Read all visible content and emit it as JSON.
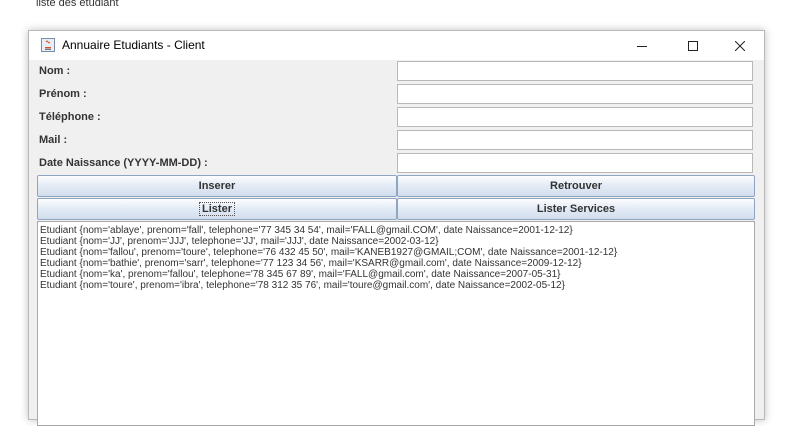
{
  "background_caption": "liste des etudiant",
  "window": {
    "title": "Annuaire Etudiants - Client",
    "controls": [
      "minimize-icon",
      "maximize-icon",
      "close-icon"
    ]
  },
  "form": {
    "fields": [
      {
        "label": "Nom :",
        "value": ""
      },
      {
        "label": "Prénom :",
        "value": ""
      },
      {
        "label": "Téléphone :",
        "value": ""
      },
      {
        "label": "Mail :",
        "value": ""
      },
      {
        "label": "Date Naissance (YYYY-MM-DD) :",
        "value": ""
      }
    ]
  },
  "buttons": {
    "inserer": "Inserer",
    "retrouver": "Retrouver",
    "lister": "Lister",
    "lister_services": "Lister Services"
  },
  "output": {
    "lines": [
      "Etudiant {nom='ablaye', prenom='fall', telephone='77 345 34 54', mail='FALL@gmail.COM', date Naissance=2001-12-12}",
      "Etudiant {nom='JJ', prenom='JJJ', telephone='JJ', mail='JJJ', date Naissance=2002-03-12}",
      "Etudiant {nom='fallou', prenom='toure', telephone='76 432 45 50', mail='KANEB1927@GMAIL;COM', date Naissance=2001-12-12}",
      "Etudiant {nom='bathie', prenom='sarr', telephone='77 123 34 56', mail='KSARR@gmail.com', date Naissance=2009-12-12}",
      "Etudiant {nom='ka', prenom='fallou', telephone='78 345 67 89', mail='FALL@gmail.com', date Naissance=2007-05-31}",
      "Etudiant {nom='toure', prenom='ibra', telephone='78 312 35 76', mail='toure@gmail.com', date Naissance=2002-05-12}"
    ]
  }
}
